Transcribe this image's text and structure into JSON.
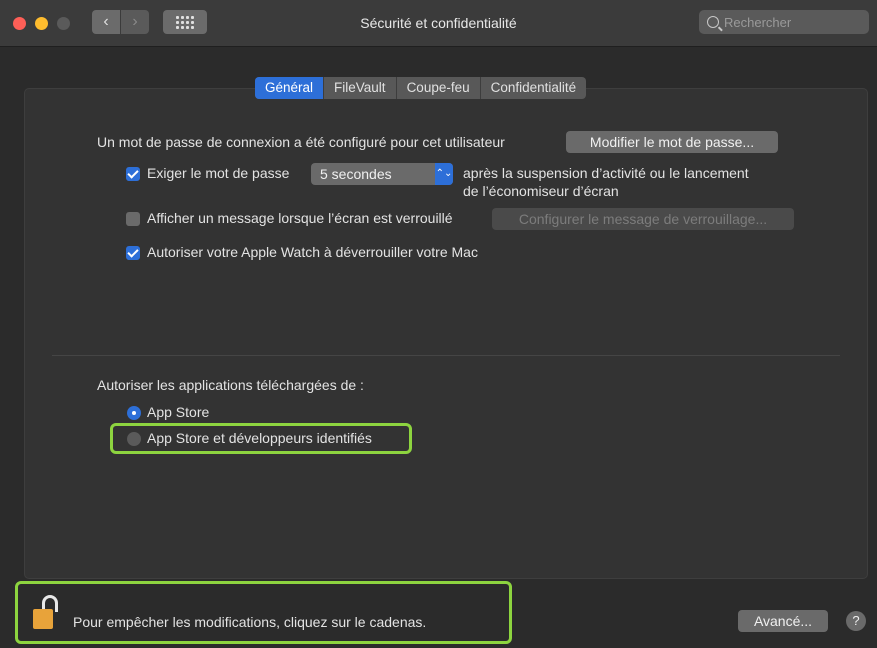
{
  "window": {
    "title": "Sécurité et confidentialité",
    "search_placeholder": "Rechercher",
    "back_glyph": "‹",
    "forward_glyph": "›"
  },
  "tabs": [
    {
      "label": "Général",
      "active": true
    },
    {
      "label": "FileVault",
      "active": false
    },
    {
      "label": "Coupe-feu",
      "active": false
    },
    {
      "label": "Confidentialité",
      "active": false
    }
  ],
  "general": {
    "password_set_text": "Un mot de passe de connexion a été configuré pour cet utilisateur",
    "change_password_button": "Modifier le mot de passe...",
    "require_password": {
      "checked": true,
      "label": "Exiger le mot de passe",
      "delay_value": "5 secondes",
      "after_line1": "après la suspension d’activité ou le lancement",
      "after_line2": "de l’économiseur d’écran"
    },
    "show_message": {
      "checked": false,
      "label": "Afficher un message lorsque l’écran est verrouillé",
      "button": "Configurer le message de verrouillage..."
    },
    "apple_watch": {
      "checked": true,
      "label": "Autoriser votre Apple Watch à déverrouiller votre Mac"
    }
  },
  "downloads": {
    "heading": "Autoriser les applications téléchargées de :",
    "options": [
      {
        "label": "App Store",
        "selected": true
      },
      {
        "label": "App Store et développeurs identifiés",
        "selected": false
      }
    ]
  },
  "footer": {
    "lock_text": "Pour empêcher les modifications, cliquez sur le cadenas.",
    "advanced_button": "Avancé...",
    "help_label": "?"
  },
  "colors": {
    "accent": "#2d6fd8",
    "highlight": "#8dd43f",
    "lock": "#e8a33a"
  }
}
